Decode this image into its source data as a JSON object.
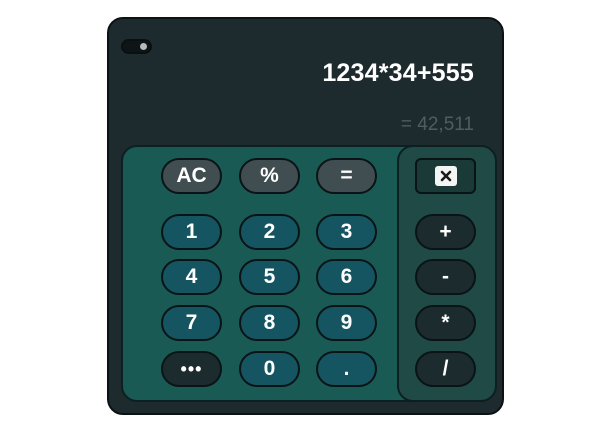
{
  "display": {
    "expression": "1234*34+555",
    "result": "= 42,511"
  },
  "keys": {
    "ac": "AC",
    "percent": "%",
    "equals": "=",
    "one": "1",
    "two": "2",
    "three": "3",
    "four": "4",
    "five": "5",
    "six": "6",
    "seven": "7",
    "eight": "8",
    "nine": "9",
    "more": "•••",
    "zero": "0",
    "decimal": ".",
    "plus": "+",
    "minus": "-",
    "multiply": "*",
    "divide": "/"
  },
  "icons": {
    "clear": "backspace-x-icon",
    "theme_toggle": "toggle-switch-icon"
  },
  "colors": {
    "body": "#1e2b2e",
    "keypad": "#1a5a54",
    "ops_panel": "#1f4a45",
    "key_gray": "#414e51",
    "key_teal": "#145561",
    "key_dark": "#1c2b2e",
    "result_text": "#4d5d60"
  }
}
